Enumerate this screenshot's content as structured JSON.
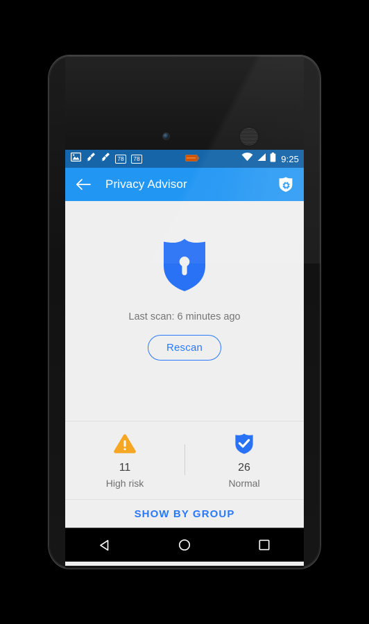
{
  "device": {
    "name": "android-phone-mockup",
    "front_camera": "camera-icon",
    "earpiece": "speaker-grille-icon"
  },
  "status_bar": {
    "background_color": "#1565a8",
    "left_icons": [
      {
        "name": "image-icon",
        "label": "image"
      },
      {
        "name": "cleaner-brush-icon-1",
        "label": "brush"
      },
      {
        "name": "cleaner-brush-icon-2",
        "label": "brush"
      },
      {
        "name": "badge-icon-1",
        "label": "78"
      },
      {
        "name": "badge-icon-2",
        "label": "78"
      }
    ],
    "center_icon": {
      "name": "battery-low-icon",
      "label": ""
    },
    "right_icons": [
      {
        "name": "wifi-icon",
        "label": "wifi"
      },
      {
        "name": "cellular-signal-icon",
        "label": "signal"
      },
      {
        "name": "battery-icon",
        "label": "battery"
      }
    ],
    "clock": "9:25"
  },
  "app_bar": {
    "background_color": "#2196f3",
    "back_label": "Back",
    "title": "Privacy Advisor",
    "action_icon_name": "shield-settings-icon"
  },
  "scan_panel": {
    "hero_icon_name": "shield-lock-icon",
    "hero_color": "#2a72f5",
    "last_scan_text": "Last scan: 6 minutes ago",
    "rescan_label": "Rescan",
    "accent_color": "#2979ff"
  },
  "stats": [
    {
      "icon_name": "warning-triangle-icon",
      "icon_color": "#f5a623",
      "count": "11",
      "label": "High risk"
    },
    {
      "icon_name": "shield-check-icon",
      "icon_color": "#2a72f5",
      "count": "26",
      "label": "Normal"
    }
  ],
  "footer": {
    "show_by_group_label": "SHOW BY GROUP",
    "color": "#2979ff"
  },
  "nav_bar": {
    "background_color": "#000000",
    "keys": [
      {
        "name": "nav-back-key",
        "label": "Back"
      },
      {
        "name": "nav-home-key",
        "label": "Home"
      },
      {
        "name": "nav-recents-key",
        "label": "Recents"
      }
    ]
  }
}
